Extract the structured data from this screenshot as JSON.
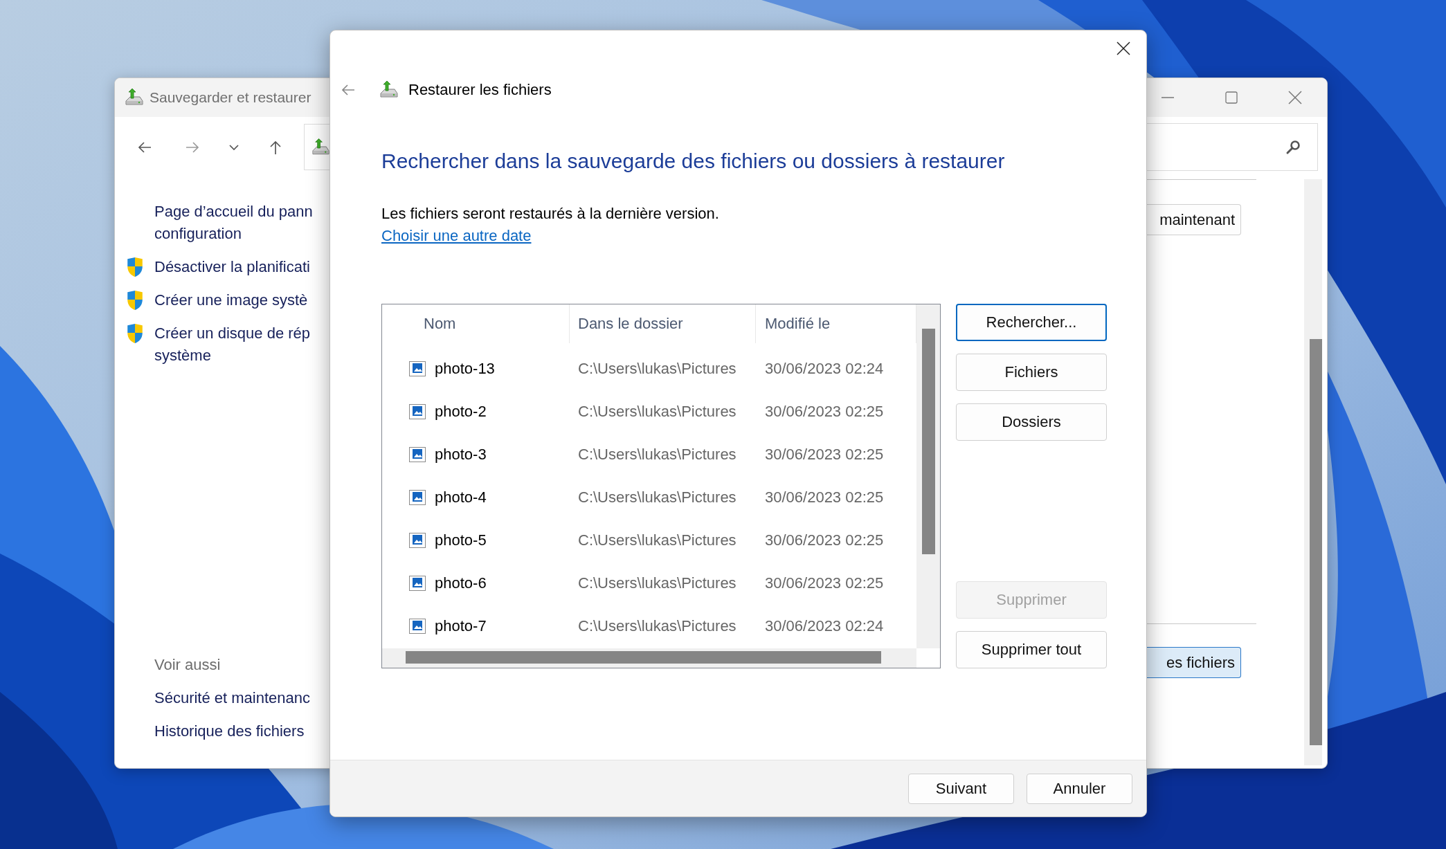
{
  "back_window": {
    "title": "Sauvegarder et restaurer",
    "sidebar": {
      "items": [
        {
          "kind": "link",
          "lines": [
            "Page d’accueil du pann",
            "configuration"
          ]
        },
        {
          "kind": "admin-link",
          "lines": [
            "Désactiver la planificati"
          ]
        },
        {
          "kind": "admin-link",
          "lines": [
            "Créer une image systè"
          ]
        },
        {
          "kind": "admin-link",
          "lines": [
            "Créer un disque de rép",
            "système"
          ]
        }
      ],
      "see_also": {
        "heading": "Voir aussi",
        "links": [
          "Sécurité et maintenanc",
          "Historique des fichiers"
        ]
      }
    },
    "buttons": [
      {
        "label": "maintenant",
        "highlighted": false
      },
      {
        "label": "es fichiers",
        "highlighted": true
      }
    ]
  },
  "dialog": {
    "title": "Restaurer les fichiers",
    "heading": "Rechercher dans la sauvegarde des fichiers ou dossiers à restaurer",
    "description": "Les fichiers seront restaurés à la dernière version.",
    "link": "Choisir une autre date",
    "table": {
      "columns": [
        "Nom",
        "Dans le dossier",
        "Modifié le"
      ],
      "rows": [
        {
          "name": "photo-13",
          "folder": "C:\\Users\\lukas\\Pictures",
          "modified": "30/06/2023 02:24"
        },
        {
          "name": "photo-2",
          "folder": "C:\\Users\\lukas\\Pictures",
          "modified": "30/06/2023 02:25"
        },
        {
          "name": "photo-3",
          "folder": "C:\\Users\\lukas\\Pictures",
          "modified": "30/06/2023 02:25"
        },
        {
          "name": "photo-4",
          "folder": "C:\\Users\\lukas\\Pictures",
          "modified": "30/06/2023 02:25"
        },
        {
          "name": "photo-5",
          "folder": "C:\\Users\\lukas\\Pictures",
          "modified": "30/06/2023 02:25"
        },
        {
          "name": "photo-6",
          "folder": "C:\\Users\\lukas\\Pictures",
          "modified": "30/06/2023 02:25"
        },
        {
          "name": "photo-7",
          "folder": "C:\\Users\\lukas\\Pictures",
          "modified": "30/06/2023 02:24"
        }
      ]
    },
    "action_buttons": [
      {
        "label": "Rechercher...",
        "default": true,
        "disabled": false
      },
      {
        "label": "Fichiers",
        "default": false,
        "disabled": false
      },
      {
        "label": "Dossiers",
        "default": false,
        "disabled": false
      }
    ],
    "remove_buttons": [
      {
        "label": "Supprimer",
        "default": false,
        "disabled": true
      },
      {
        "label": "Supprimer tout",
        "default": false,
        "disabled": false
      }
    ],
    "footer_buttons": [
      {
        "label": "Suivant"
      },
      {
        "label": "Annuler"
      }
    ]
  }
}
